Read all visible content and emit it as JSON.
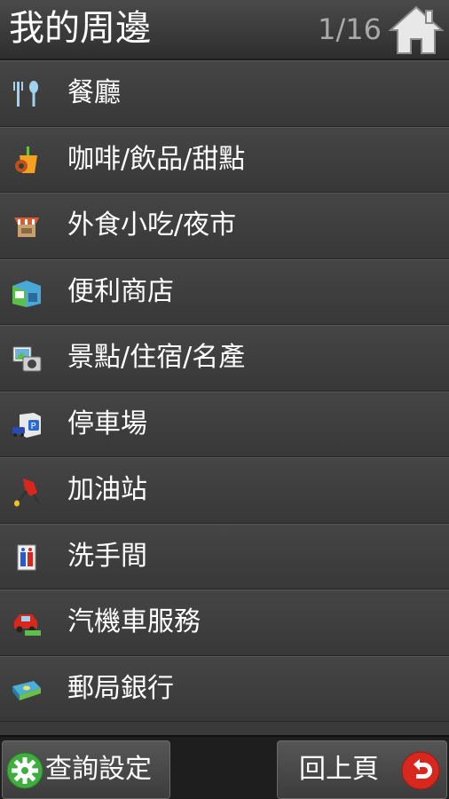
{
  "header": {
    "title": "我的周邊",
    "page_indicator": "1/16"
  },
  "categories": [
    {
      "label": "餐廳"
    },
    {
      "label": "咖啡/飲品/甜點"
    },
    {
      "label": "外食小吃/夜市"
    },
    {
      "label": "便利商店"
    },
    {
      "label": "景點/住宿/名產"
    },
    {
      "label": "停車場"
    },
    {
      "label": "加油站"
    },
    {
      "label": "洗手間"
    },
    {
      "label": "汽機車服務"
    },
    {
      "label": "郵局銀行"
    }
  ],
  "footer": {
    "settings_label": "查詢設定",
    "back_label": "回上頁"
  },
  "icons": {
    "home": "home-icon",
    "settings": "gear-icon",
    "back": "back-arrow-icon"
  },
  "colors": {
    "row_bg": "#3f3f3f",
    "settings_green": "#3fae3f",
    "back_red": "#d8281e",
    "page_indicator": "#a9a9a9"
  }
}
